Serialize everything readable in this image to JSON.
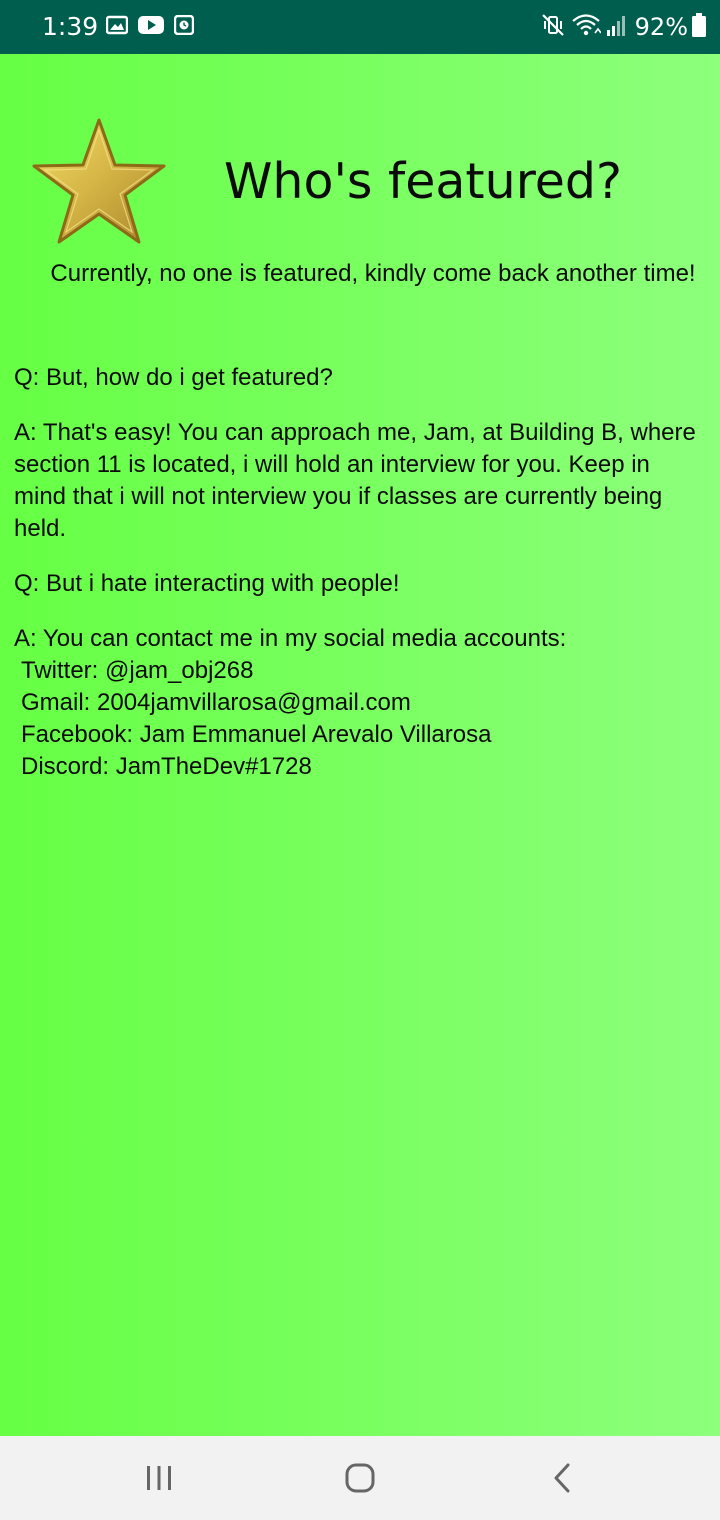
{
  "status_bar": {
    "time": "1:39",
    "battery": "92%",
    "left_icons": [
      "image-icon",
      "youtube-icon",
      "clock-app-icon"
    ],
    "right_icons": [
      "mute-vibrate-icon",
      "wifi-icon",
      "signal-icon",
      "battery-icon"
    ]
  },
  "header": {
    "icon": "star-icon",
    "title": "Who's featured?"
  },
  "message": "Currently, no one is featured, kindly come back another time!",
  "faq": [
    {
      "text": "Q: But, how do i get featured?"
    },
    {
      "text": "A: That's easy! You can approach me, Jam, at Building B, where section 11 is located, i will hold an interview for you. Keep in mind that i will not interview you if classes are currently being held."
    },
    {
      "text": "Q: But i hate interacting with people!"
    },
    {
      "text": "A: You can contact me in my social media accounts:"
    }
  ],
  "contacts": [
    "Twitter: @jam_obj268",
    "Gmail: 2004jamvillarosa@gmail.com",
    "Facebook: Jam Emmanuel Arevalo Villarosa",
    "Discord: JamTheDev#1728"
  ],
  "nav_bar": {
    "buttons": [
      "recent-apps-icon",
      "home-icon",
      "back-icon"
    ]
  },
  "colors": {
    "status_bar": "#005e4e",
    "gradient_start": "#66ff44",
    "gradient_end": "#8dff7c",
    "nav_bar": "#f2f2f2",
    "star_gold": "#d4b445"
  }
}
